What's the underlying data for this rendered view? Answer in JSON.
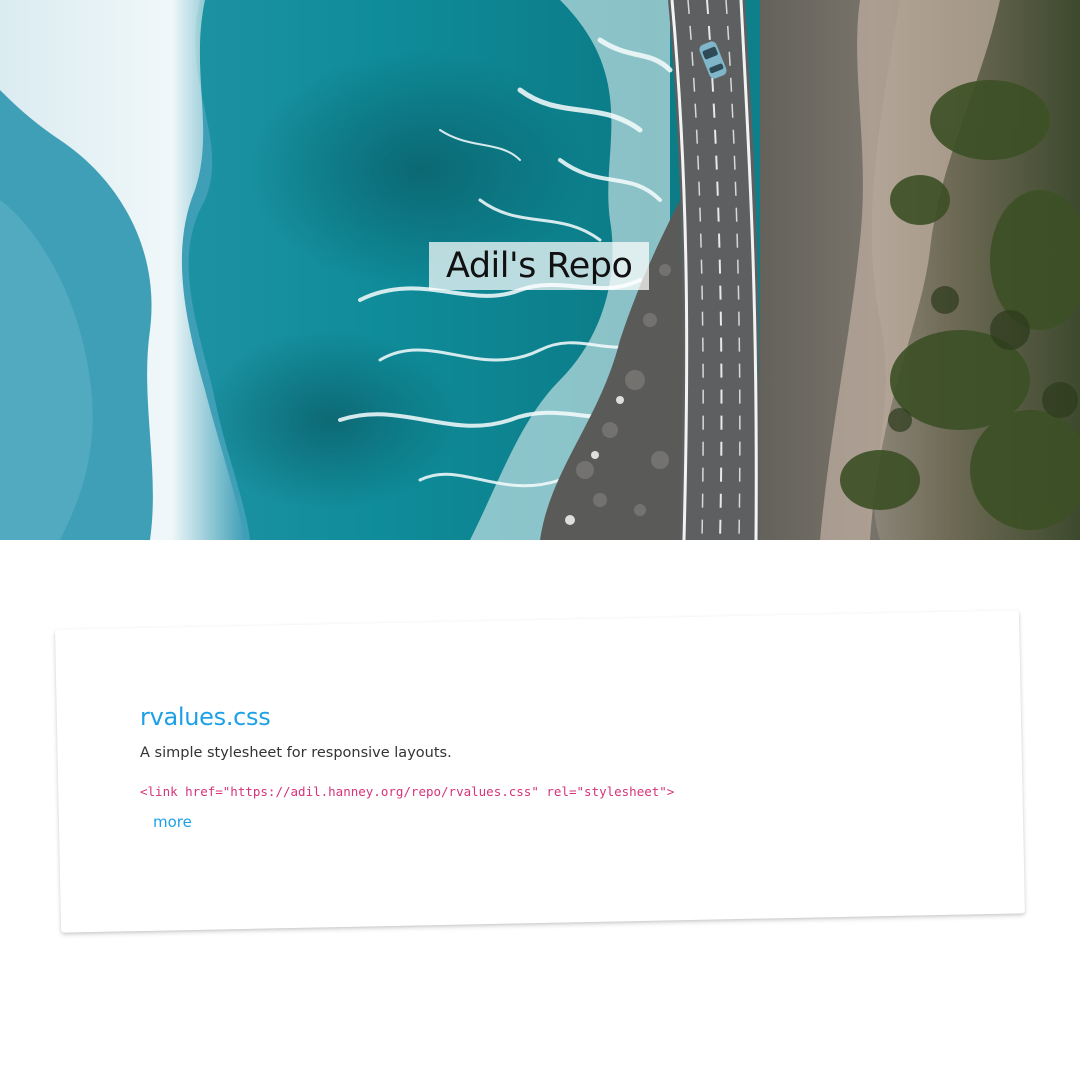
{
  "hero": {
    "title": "Adil's Repo",
    "image": "aerial-coastal-road"
  },
  "project": {
    "name": "rvalues.css",
    "description": "A simple stylesheet for responsive layouts.",
    "code_snippet": "<link href=\"https://adil.hanney.org/repo/rvalues.css\" rel=\"stylesheet\">",
    "more_label": "more"
  },
  "colors": {
    "link": "#1da1e6",
    "code": "#d6337a",
    "text": "#333333"
  }
}
